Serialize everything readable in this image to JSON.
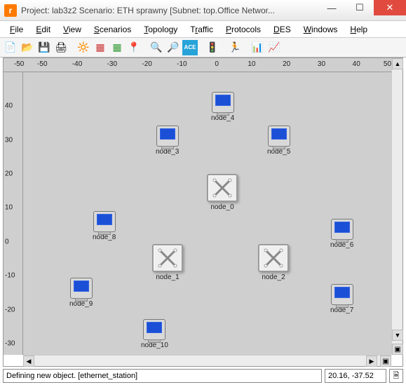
{
  "window": {
    "title": "Project: lab3z2 Scenario: ETH sprawny  [Subnet: top.Office Networ..."
  },
  "menu": {
    "file": "File",
    "edit": "Edit",
    "view": "View",
    "scenarios": "Scenarios",
    "topology": "Topology",
    "traffic": "Traffic",
    "protocols": "Protocols",
    "des": "DES",
    "windows": "Windows",
    "help": "Help"
  },
  "ruler_x": [
    "-50",
    "-50",
    "-40",
    "-30",
    "-20",
    "-10",
    "0",
    "10",
    "20",
    "30",
    "40",
    "50"
  ],
  "ruler_y": [
    "40",
    "30",
    "20",
    "10",
    "0",
    "-10",
    "-20",
    "-30"
  ],
  "nodes": {
    "node_0": "node_0",
    "node_1": "node_1",
    "node_2": "node_2",
    "node_3": "node_3",
    "node_4": "node_4",
    "node_5": "node_5",
    "node_6": "node_6",
    "node_7": "node_7",
    "node_8": "node_8",
    "node_9": "node_9",
    "node_10": "node_10"
  },
  "status": {
    "message": "Defining new object. [ethernet_station]",
    "coord": "20.16, -37.52"
  }
}
